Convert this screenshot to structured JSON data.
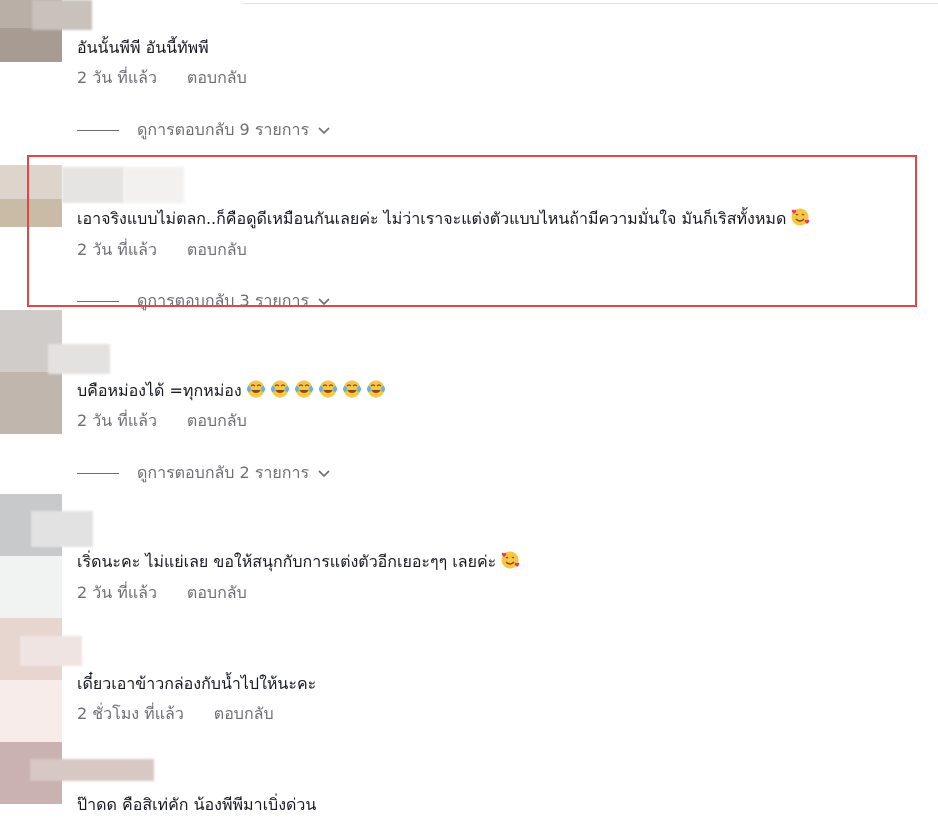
{
  "comments": [
    {
      "text": "อันนั้นพีพี อันนี้ทัพพี",
      "time": "2 วัน ที่แล้ว",
      "reply": "ตอบกลับ",
      "view_replies": "ดูการตอบกลับ 9 รายการ"
    },
    {
      "text": "เอาจริงแบบไม่ตลก..ก็คือดูดีเหมือนกันเลยค่ะ ไม่ว่าเราจะแต่งตัวแบบไหนถ้ามีความมั่นใจ มันก็เริสทั้งหมด",
      "time": "2 วัน ที่แล้ว",
      "reply": "ตอบกลับ",
      "view_replies": "ดูการตอบกลับ 3 รายการ",
      "emoji": "smiling-face-with-hearts"
    },
    {
      "text": "บคือหม่องได้ =ทุกหม่อง",
      "time": "2 วัน ที่แล้ว",
      "reply": "ตอบกลับ",
      "view_replies": "ดูการตอบกลับ 2 รายการ",
      "emoji": "face-with-tears-of-joy"
    },
    {
      "text": "เริ่ดนะคะ ไม่แย่เลย ขอให้สนุกกับการแต่งตัวอีกเยอะๆๆ เลยค่ะ",
      "time": "2 วัน ที่แล้ว",
      "reply": "ตอบกลับ",
      "emoji": "smiling-face-with-hearts"
    },
    {
      "text": "เดี๋ยวเอาข้าวกล่องกับน้ำไปให้นะคะ",
      "time": "2 ชั่วโมง ที่แล้ว",
      "reply": "ตอบกลับ"
    },
    {
      "text": "ป๊าดด คือสิเท่คัก น้องพีพีมาเบิ่งด่วน"
    }
  ],
  "colors": {
    "text": "#161823",
    "meta": "#6d6e73",
    "highlight_border": "#e04848"
  }
}
